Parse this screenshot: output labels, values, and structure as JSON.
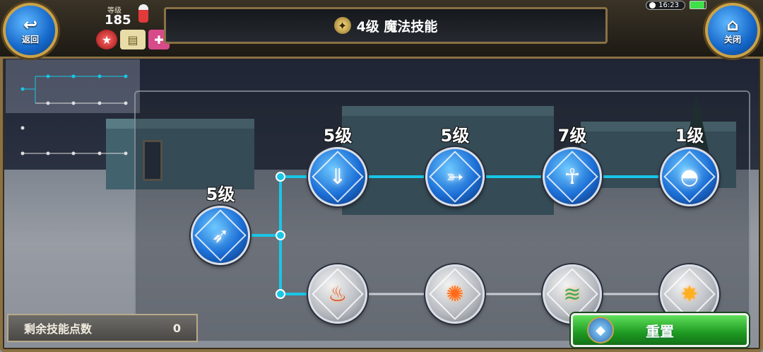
{
  "top_bar": {
    "back_label": "返回",
    "close_label": "关闭",
    "title": "4级 魔法技能",
    "level_label": "等级",
    "level_value": "185",
    "time": "16:23"
  },
  "skill_tree": {
    "root": {
      "level": "5级",
      "icon": "piercing-arrow-skill-icon",
      "state": "unlocked"
    },
    "top_row": [
      {
        "level": "5级",
        "icon": "downward-arrow-skill-icon",
        "state": "unlocked"
      },
      {
        "level": "5级",
        "icon": "triple-arrow-skill-icon",
        "state": "unlocked"
      },
      {
        "level": "7级",
        "icon": "spirit-figure-skill-icon",
        "state": "unlocked"
      },
      {
        "level": "1级",
        "icon": "fire-dome-skill-icon",
        "state": "unlocked"
      }
    ],
    "bottom_row": [
      {
        "level": "",
        "icon": "fire-pillar-skill-icon",
        "state": "locked"
      },
      {
        "level": "",
        "icon": "explosion-skill-icon",
        "state": "locked"
      },
      {
        "level": "",
        "icon": "tornado-skill-icon",
        "state": "locked"
      },
      {
        "level": "",
        "icon": "burst-skill-icon",
        "state": "locked"
      }
    ]
  },
  "footer": {
    "points_label": "剩余技能点数",
    "points_value": "0",
    "reset_label": "重置"
  },
  "colors": {
    "link_line": "#19c6e6",
    "frame_gold": "#8a7144",
    "reset_green": "#1e9a22"
  }
}
